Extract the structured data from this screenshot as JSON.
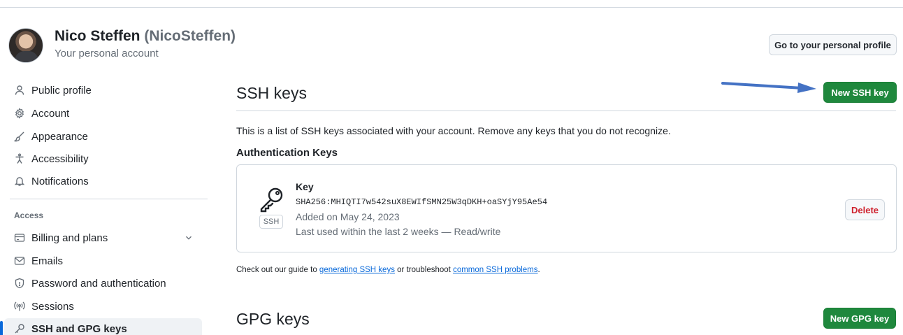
{
  "account": {
    "name": "Nico Steffen",
    "login": "(NicoSteffen)",
    "subtitle": "Your personal account",
    "profile_button": "Go to your personal profile"
  },
  "sidebar": {
    "items": [
      {
        "label": "Public profile",
        "icon": "person-icon"
      },
      {
        "label": "Account",
        "icon": "gear-icon"
      },
      {
        "label": "Appearance",
        "icon": "paintbrush-icon"
      },
      {
        "label": "Accessibility",
        "icon": "accessibility-icon"
      },
      {
        "label": "Notifications",
        "icon": "bell-icon"
      }
    ],
    "access_heading": "Access",
    "access_items": [
      {
        "label": "Billing and plans",
        "icon": "credit-card-icon"
      },
      {
        "label": "Emails",
        "icon": "mail-icon"
      },
      {
        "label": "Password and authentication",
        "icon": "shield-lock-icon"
      },
      {
        "label": "Sessions",
        "icon": "broadcast-icon"
      },
      {
        "label": "SSH and GPG keys",
        "icon": "key-icon",
        "active": true
      }
    ]
  },
  "ssh": {
    "title": "SSH keys",
    "new_button": "New SSH key",
    "description": "This is a list of SSH keys associated with your account. Remove any keys that you do not recognize.",
    "auth_heading": "Authentication Keys",
    "key": {
      "title": "Key",
      "fingerprint": "SHA256:MHIQTI7w542suX8EWIfSMN25W3qDKH+oaSYjY95Ae54",
      "added": "Added on May 24, 2023",
      "last_used": "Last used within the last 2 weeks — Read/write",
      "tag": "SSH",
      "delete_button": "Delete"
    },
    "guide": {
      "prefix": "Check out our guide to ",
      "link1": "generating SSH keys",
      "middle": " or troubleshoot ",
      "link2": "common SSH problems",
      "suffix": "."
    }
  },
  "gpg": {
    "title": "GPG keys",
    "new_button": "New GPG key"
  },
  "colors": {
    "primary_button": "#1f883d",
    "link": "#0969da",
    "danger": "#cf222e",
    "active_indicator": "#0969da",
    "annotation_arrow": "#4472c4"
  }
}
